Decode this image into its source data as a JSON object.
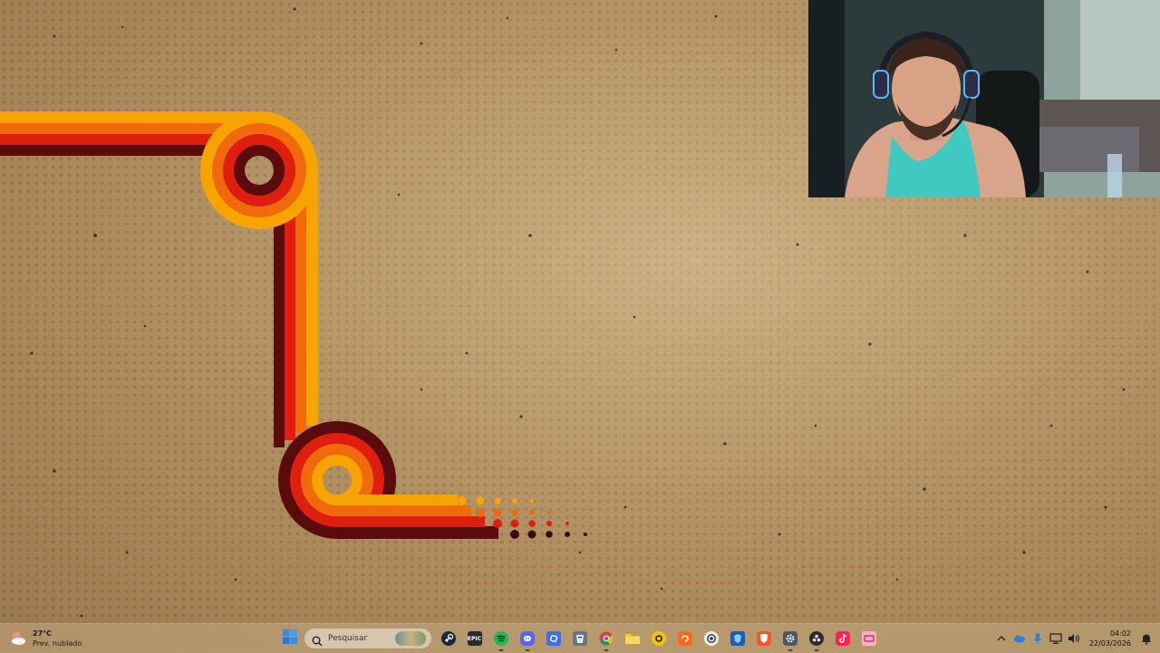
{
  "desktop": {
    "wallpaper": "retro-stripes-wallpaper",
    "colors": {
      "background": "#b08f62",
      "stripe_yellow": "#f7a400",
      "stripe_orange": "#f06a0c",
      "stripe_red": "#e01e10",
      "stripe_dark": "#5a0b0b"
    }
  },
  "webcam": {
    "label": "webcam-overlay"
  },
  "taskbar": {
    "weather": {
      "temp": "27°C",
      "desc": "Prev. nublado",
      "icon": "cloudy-sun-icon"
    },
    "start_icon": "windows-start-icon",
    "search": {
      "placeholder": "Pesquisar"
    },
    "apps": [
      {
        "name": "steam",
        "icon": "steam-icon"
      },
      {
        "name": "epic-games",
        "icon": "epic-games-icon",
        "text": "EPIC"
      },
      {
        "name": "spotify",
        "icon": "spotify-icon"
      },
      {
        "name": "discord",
        "icon": "discord-icon"
      },
      {
        "name": "app-blue",
        "icon": "blue-app-icon"
      },
      {
        "name": "app-grey",
        "icon": "grey-app-icon"
      },
      {
        "name": "chrome",
        "icon": "chrome-icon"
      },
      {
        "name": "file-explorer",
        "icon": "folder-icon"
      },
      {
        "name": "app-yellow",
        "icon": "yellow-circle-icon"
      },
      {
        "name": "app-orange",
        "icon": "orange-app-icon"
      },
      {
        "name": "app-ring",
        "icon": "ring-app-icon"
      },
      {
        "name": "app-shield",
        "icon": "shield-app-icon"
      },
      {
        "name": "brave",
        "icon": "brave-icon"
      },
      {
        "name": "settings",
        "icon": "gear-icon"
      },
      {
        "name": "obs",
        "icon": "obs-icon"
      },
      {
        "name": "tiktok",
        "icon": "tiktok-icon"
      },
      {
        "name": "app-pink",
        "icon": "pink-app-icon"
      }
    ],
    "tray": {
      "time": "04:02",
      "date": "22/03/2026"
    }
  }
}
